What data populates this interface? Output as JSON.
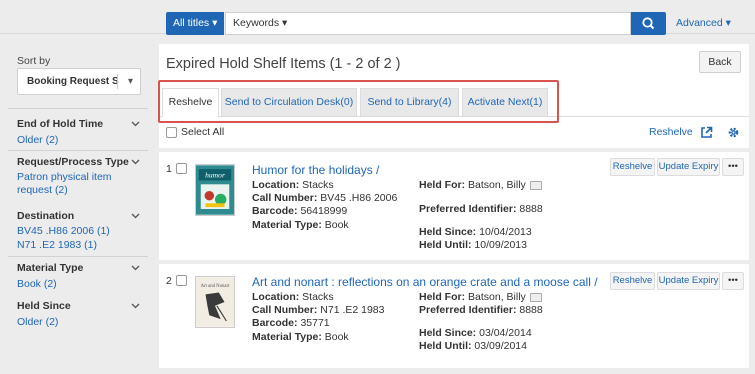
{
  "search": {
    "scope": "All titles ▾",
    "type": "Keywords ▾",
    "value": "",
    "advanced": "Advanced ▾"
  },
  "sidebar": {
    "sort_by_label": "Sort by",
    "sort_value": "Booking Request S",
    "facets": [
      {
        "title": "End of Hold Time",
        "items": [
          "Older (2)"
        ]
      },
      {
        "title": "Request/Process Type",
        "items": [
          "Patron physical item",
          "request (2)"
        ]
      },
      {
        "title": "Destination",
        "items": [
          "BV45 .H86 2006 (1)",
          "N71 .E2 1983 (1)"
        ]
      },
      {
        "title": "Material Type",
        "items": [
          "Book (2)"
        ]
      },
      {
        "title": "Held Since",
        "items": [
          "Older (2)"
        ]
      }
    ]
  },
  "main": {
    "title": "Expired Hold Shelf Items (1 - 2 of 2 )",
    "back": "Back",
    "tabs": [
      {
        "label": "Reshelve"
      },
      {
        "label": "Send to Circulation Desk(0)"
      },
      {
        "label": "Send to Library(4)"
      },
      {
        "label": "Activate Next(1)"
      }
    ],
    "select_all": "Select All",
    "reshelve_link": "Reshelve",
    "colors": {
      "accent": "#1f66b5",
      "highlight": "#d9534f"
    }
  },
  "results": [
    {
      "num": "1",
      "title": "Humor for the holidays /",
      "location_label": "Location:",
      "location": "Stacks",
      "call_label": "Call Number:",
      "call": "BV45 .H86 2006",
      "barcode_label": "Barcode:",
      "barcode": "56418999",
      "mat_label": "Material Type:",
      "mat": "Book",
      "held_for_label": "Held For:",
      "held_for": "Batson, Billy",
      "pref_label": "Preferred Identifier:",
      "pref": "8888",
      "since_label": "Held Since:",
      "since": "10/04/2013",
      "until_label": "Held Until:",
      "until": "10/09/2013",
      "btn_reshelve": "Reshelve",
      "btn_update": "Update Expiry",
      "btn_more": "•••"
    },
    {
      "num": "2",
      "title": "Art and nonart : reflections on an orange crate and a moose call /",
      "location_label": "Location:",
      "location": "Stacks",
      "call_label": "Call Number:",
      "call": "N71 .E2 1983",
      "barcode_label": "Barcode:",
      "barcode": "35771",
      "mat_label": "Material Type:",
      "mat": "Book",
      "held_for_label": "Held For:",
      "held_for": "Batson, Billy",
      "pref_label": "Preferred Identifier:",
      "pref": "8888",
      "since_label": "Held Since:",
      "since": "03/04/2014",
      "until_label": "Held Until:",
      "until": "03/09/2014",
      "btn_reshelve": "Reshelve",
      "btn_update": "Update Expiry",
      "btn_more": "•••"
    }
  ],
  "icons": {
    "search": "search-icon",
    "export": "export-icon",
    "settings": "gear-icon",
    "user": "user-card-icon"
  }
}
